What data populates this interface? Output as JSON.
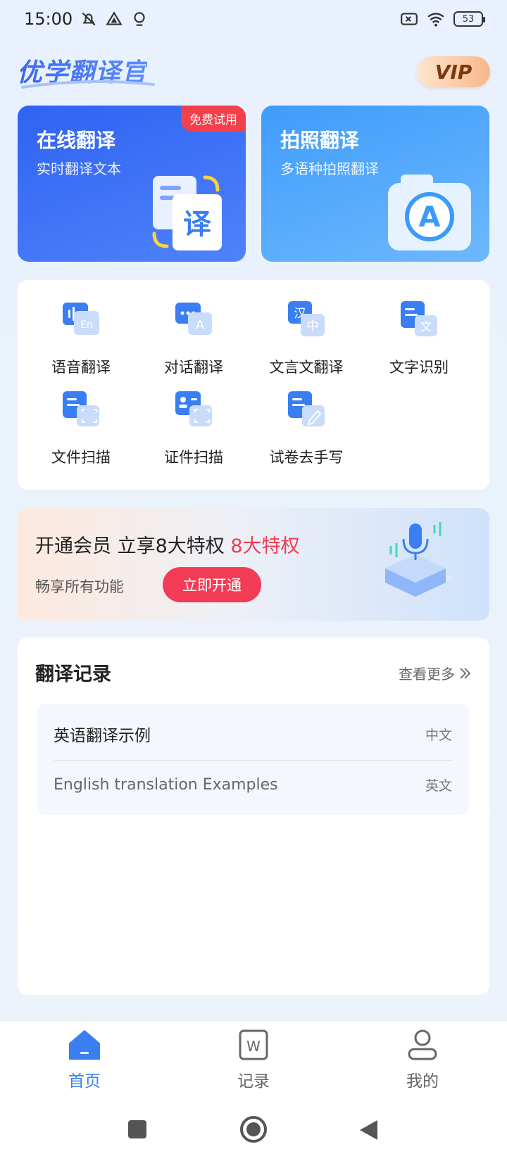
{
  "status_bar": {
    "time": "15:00",
    "battery": "53"
  },
  "header": {
    "app_title": "优学翻译官",
    "vip_label": "VIP"
  },
  "cards": {
    "online": {
      "title": "在线翻译",
      "subtitle": "实时翻译文本",
      "badge": "免费试用",
      "art_glyph": "译"
    },
    "photo": {
      "title": "拍照翻译",
      "subtitle": "多语种拍照翻译",
      "art_glyph": "A"
    }
  },
  "features": [
    {
      "label": "语音翻译",
      "icon": "voice-translate-icon",
      "glyph": "En"
    },
    {
      "label": "对话翻译",
      "icon": "dialog-translate-icon",
      "glyph": "A"
    },
    {
      "label": "文言文翻译",
      "icon": "classical-translate-icon",
      "glyph": "中"
    },
    {
      "label": "文字识别",
      "icon": "text-recognize-icon",
      "glyph": "文"
    },
    {
      "label": "文件扫描",
      "icon": "file-scan-icon",
      "glyph": ""
    },
    {
      "label": "证件扫描",
      "icon": "id-scan-icon",
      "glyph": ""
    },
    {
      "label": "试卷去手写",
      "icon": "remove-handwriting-icon",
      "glyph": ""
    }
  ],
  "feature_glyph_han": "汉",
  "promo": {
    "headline": "开通会员 立享8大特权",
    "highlight": "8大特权",
    "subtitle": "畅享所有功能",
    "button": "立即开通"
  },
  "records": {
    "title": "翻译记录",
    "more": "查看更多",
    "items": [
      {
        "text": "英语翻译示例",
        "lang": "中文"
      },
      {
        "text": "English translation Examples",
        "lang": "英文"
      }
    ]
  },
  "nav": [
    {
      "label": "首页",
      "active": true
    },
    {
      "label": "记录",
      "active": false,
      "glyph": "W"
    },
    {
      "label": "我的",
      "active": false
    }
  ],
  "colors": {
    "primary": "#3a7ff2",
    "accent_red": "#f23c55",
    "card_online": "#2f63f2",
    "card_photo": "#3f9cfb"
  }
}
